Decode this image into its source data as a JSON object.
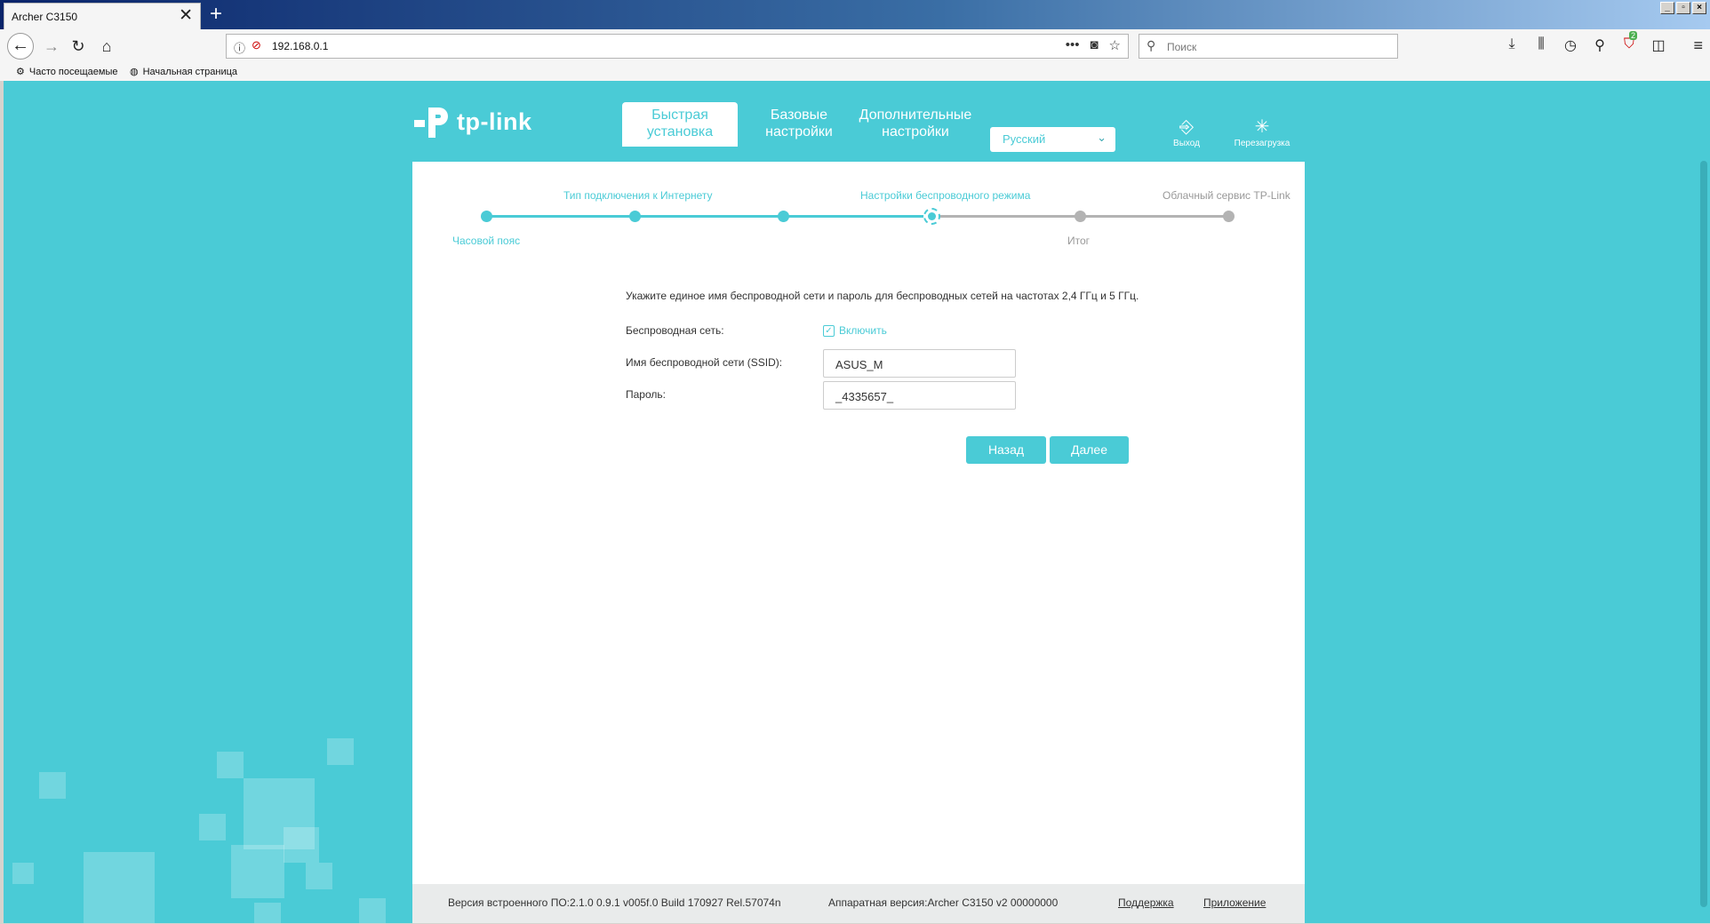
{
  "browser": {
    "tab_title": "Archer C3150",
    "tab_close": "✕",
    "new_tab": "+",
    "url": "192.168.0.1",
    "search_placeholder": "Поиск",
    "shield_badge_count": "2",
    "bookmarks": [
      "Часто посещаемые",
      "Начальная страница"
    ]
  },
  "header": {
    "logo_text": "tp-link",
    "tabs": [
      {
        "label_line1": "Быстрая",
        "label_line2": "установка"
      },
      {
        "label_line1": "Базовые",
        "label_line2": "настройки"
      },
      {
        "label_line1": "Дополнительные",
        "label_line2": "настройки"
      }
    ],
    "language": "Русский",
    "logout_label": "Выход",
    "reboot_label": "Перезагрузка"
  },
  "stepper": {
    "steps": [
      {
        "label": "Часовой пояс",
        "state": "done"
      },
      {
        "label": "Тип подключения к Интернету",
        "state": "done"
      },
      {
        "label": "",
        "state": "done"
      },
      {
        "label": "Настройки беспроводного режима",
        "state": "current"
      },
      {
        "label": "Итог",
        "state": "todo"
      },
      {
        "label": "Облачный сервис TP-Link",
        "state": "todo"
      }
    ]
  },
  "wireless": {
    "intro": "Укажите единое имя беспроводной сети и пароль для беспроводных сетей на частотах 2,4 ГГц и 5 ГГц.",
    "wireless_label": "Беспроводная сеть:",
    "enable_label": "Включить",
    "enabled": true,
    "ssid_label": "Имя беспроводной сети (SSID):",
    "ssid_value": "ASUS_M",
    "password_label": "Пароль:",
    "password_value": "_4335657_"
  },
  "buttons": {
    "back": "Назад",
    "next": "Далее"
  },
  "footer": {
    "firmware": "Версия встроенного ПО:2.1.0 0.9.1 v005f.0 Build 170927 Rel.57074n",
    "hardware": "Аппаратная версия:Archer C3150 v2 00000000",
    "support": "Поддержка",
    "app": "Приложение"
  },
  "colors": {
    "accent": "#4acbd6",
    "inactive": "#b3b3b3"
  }
}
